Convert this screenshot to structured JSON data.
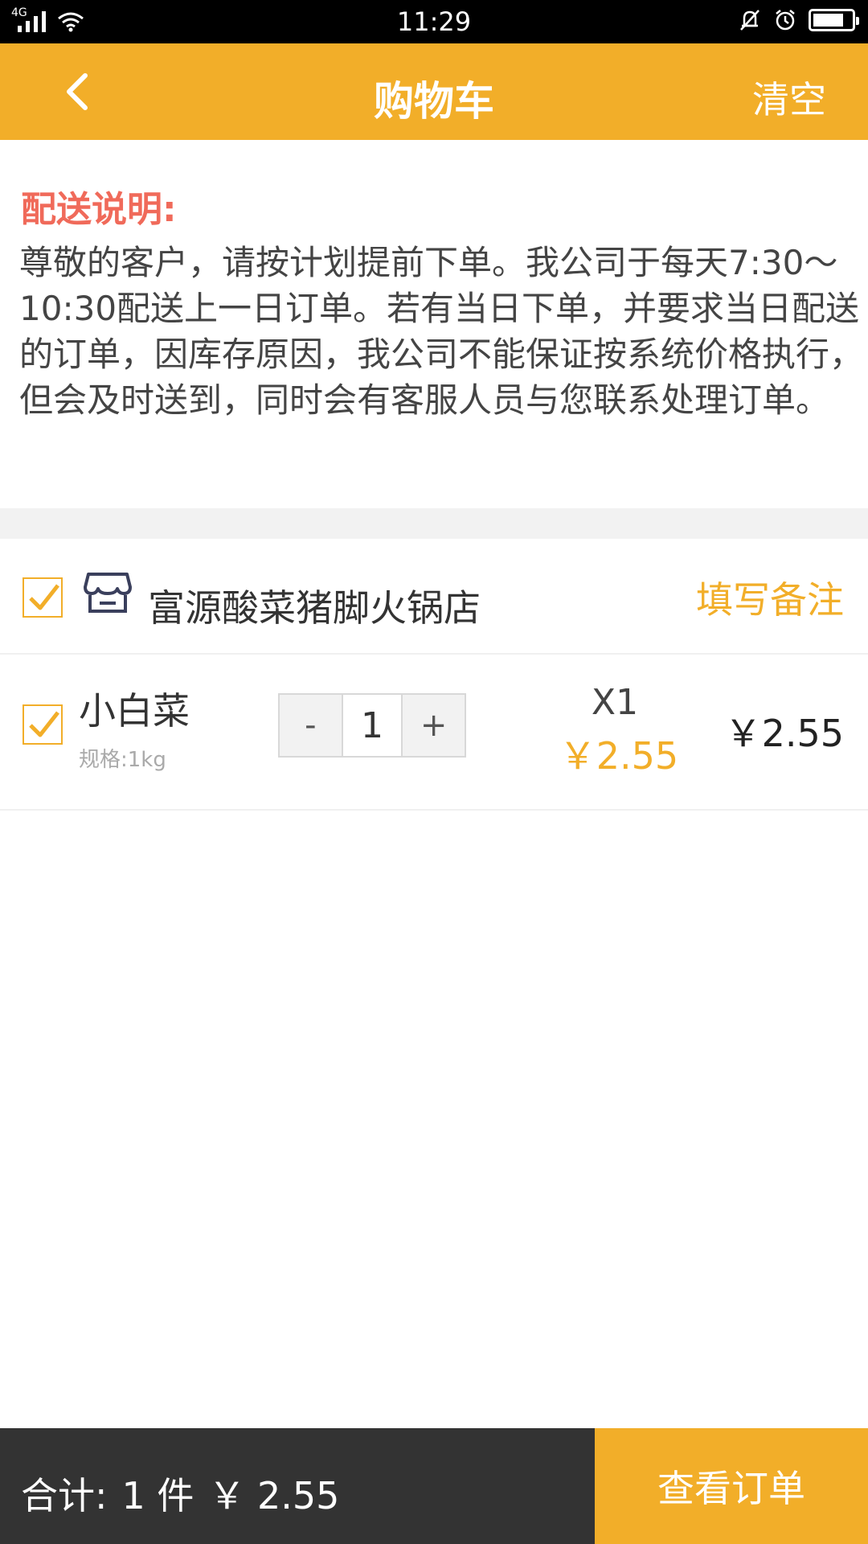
{
  "status_bar": {
    "network": "4G",
    "time": "11:29"
  },
  "nav": {
    "title": "购物车",
    "clear_label": "清空"
  },
  "notice": {
    "title": "配送说明:",
    "body": "尊敬的客户，请按计划提前下单。我公司于每天7:30～10:30配送上一日订单。若有当日下单，并要求当日配送的订单，因库存原因，我公司不能保证按系统价格执行，但会及时送到，同时会有客服人员与您联系处理订单。"
  },
  "shop": {
    "name": "富源酸菜猪脚火锅店",
    "note_label": "填写备注",
    "checked": true
  },
  "items": [
    {
      "name": "小白菜",
      "spec": "规格:1kg",
      "minus_label": "-",
      "quantity": "1",
      "plus_label": "+",
      "qty_label": "X1",
      "unit_price": "￥2.55",
      "subtotal": "￥2.55",
      "checked": true
    }
  ],
  "bottom": {
    "total_prefix": "合计:",
    "total_count": "1 件",
    "total_amount": "￥ 2.55",
    "view_order_label": "查看订单"
  },
  "colors": {
    "accent": "#f2ae29",
    "notice_title": "#f06a5a",
    "bottom_dark": "#333333"
  }
}
